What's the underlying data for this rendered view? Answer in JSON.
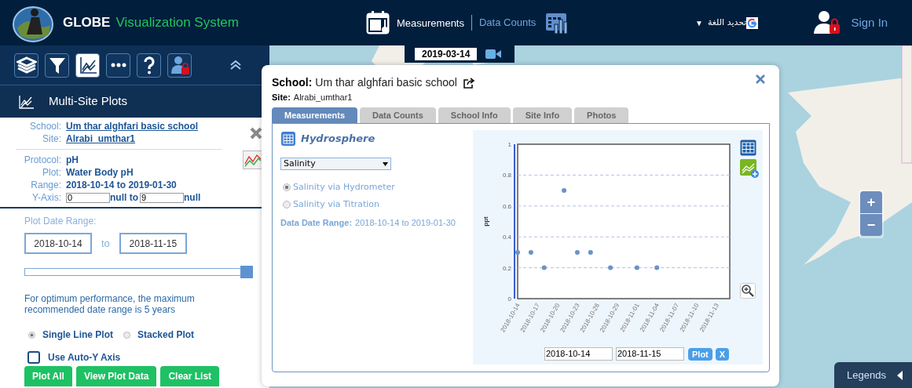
{
  "header": {
    "brand": "GLOBE",
    "brand_subtitle": "Visualization System",
    "nav": [
      {
        "label": "Measurements",
        "selected": true
      },
      {
        "label": "Data Counts",
        "selected": false
      }
    ],
    "translate": "تحديد اللغة",
    "translate_caret": "▼",
    "sign_in": "Sign In"
  },
  "sidebar": {
    "tools": [
      {
        "kind": "layers",
        "selected": false
      },
      {
        "kind": "filter",
        "selected": false
      },
      {
        "kind": "plots",
        "selected": true
      },
      {
        "kind": "more",
        "selected": false
      },
      {
        "kind": "help",
        "selected": false
      },
      {
        "kind": "user",
        "selected": false
      }
    ],
    "title": "Multi-Site Plots",
    "site_fields": [
      {
        "label": "School:",
        "value": "Um thar alghfari basic school"
      },
      {
        "label": "Site:",
        "value": "Alrabi_umthar1"
      }
    ],
    "plot_fields": [
      {
        "label": "Protocol:",
        "value": "pH"
      },
      {
        "label": "Plot:",
        "value": "Water Body pH"
      },
      {
        "label": "Range:",
        "value": "2018-10-14 to 2019-01-30"
      }
    ],
    "y_axis": {
      "label": "Y-Axis:",
      "min": "0",
      "min_suffix": "null to",
      "max": "9",
      "max_suffix": "null"
    },
    "plot_date_range": {
      "label": "Plot Date Range:",
      "from": "2018-10-14",
      "to_label": "to",
      "to": "2018-11-15"
    },
    "range_slider": {
      "level": 1
    },
    "note": "For optimum performance, the maximum recommended date range is 5 years",
    "plot_types": [
      {
        "label": "Single Line Plot",
        "selected": true
      },
      {
        "label": "Stacked Plot",
        "selected": false
      }
    ],
    "auto_y": {
      "label": "Use Auto-Y Axis",
      "checked": false
    },
    "buttons": [
      "Plot All",
      "View Plot Data",
      "Clear List"
    ]
  },
  "map": {
    "date": "2019-03-14",
    "zoom_in": "+",
    "zoom_out": "−",
    "legends": "Legends"
  },
  "popup": {
    "school_label": "School:",
    "school": "Um thar alghfari basic school",
    "site_label": "Site:",
    "site": "Alrabi_umthar1",
    "tabs": [
      {
        "label": "Measurements",
        "selected": true
      },
      {
        "label": "Data Counts",
        "selected": false
      },
      {
        "label": "School Info",
        "selected": false
      },
      {
        "label": "Site Info",
        "selected": false
      },
      {
        "label": "Photos",
        "selected": false
      }
    ],
    "category": "Hydrosphere",
    "select": "Salinity",
    "options": [
      {
        "label": "Salinity via Hydrometer",
        "selected": true
      },
      {
        "label": "Salinity via Titration",
        "selected": false
      }
    ],
    "date_range_label": "Data Date Range:",
    "date_range": "2018-10-14 to 2019-01-30",
    "chart_data": {
      "type": "scatter",
      "ylabel": "ppt",
      "x": [
        "2018-10-14",
        "2018-10-16",
        "2018-10-18",
        "2018-10-21",
        "2018-10-23",
        "2018-10-25",
        "2018-10-28",
        "2018-11-01",
        "2018-11-04"
      ],
      "grid": true,
      "series": [
        {
          "color": "#6a93c6",
          "values": [
            0.3,
            0.3,
            0.2,
            0.7,
            0.3,
            0.3,
            0.2,
            0.2,
            0.2
          ]
        }
      ],
      "xlim": [
        "2018-10-14",
        "2018-11-15"
      ],
      "ylim": [
        0,
        1
      ],
      "xticks": [
        "2018-10-14",
        "2018-10-17",
        "2018-10-20",
        "2018-10-23",
        "2018-10-26",
        "2018-10-29",
        "2018-11-01",
        "2018-11-04",
        "2018-11-07",
        "2018-11-10",
        "2018-11-13"
      ],
      "yticks": [
        0,
        0.2,
        0.4,
        0.6,
        0.8,
        1
      ]
    },
    "chart_from": "2018-10-14",
    "chart_to": "2018-11-15",
    "plot_button": "Plot",
    "clear_button": "X"
  }
}
